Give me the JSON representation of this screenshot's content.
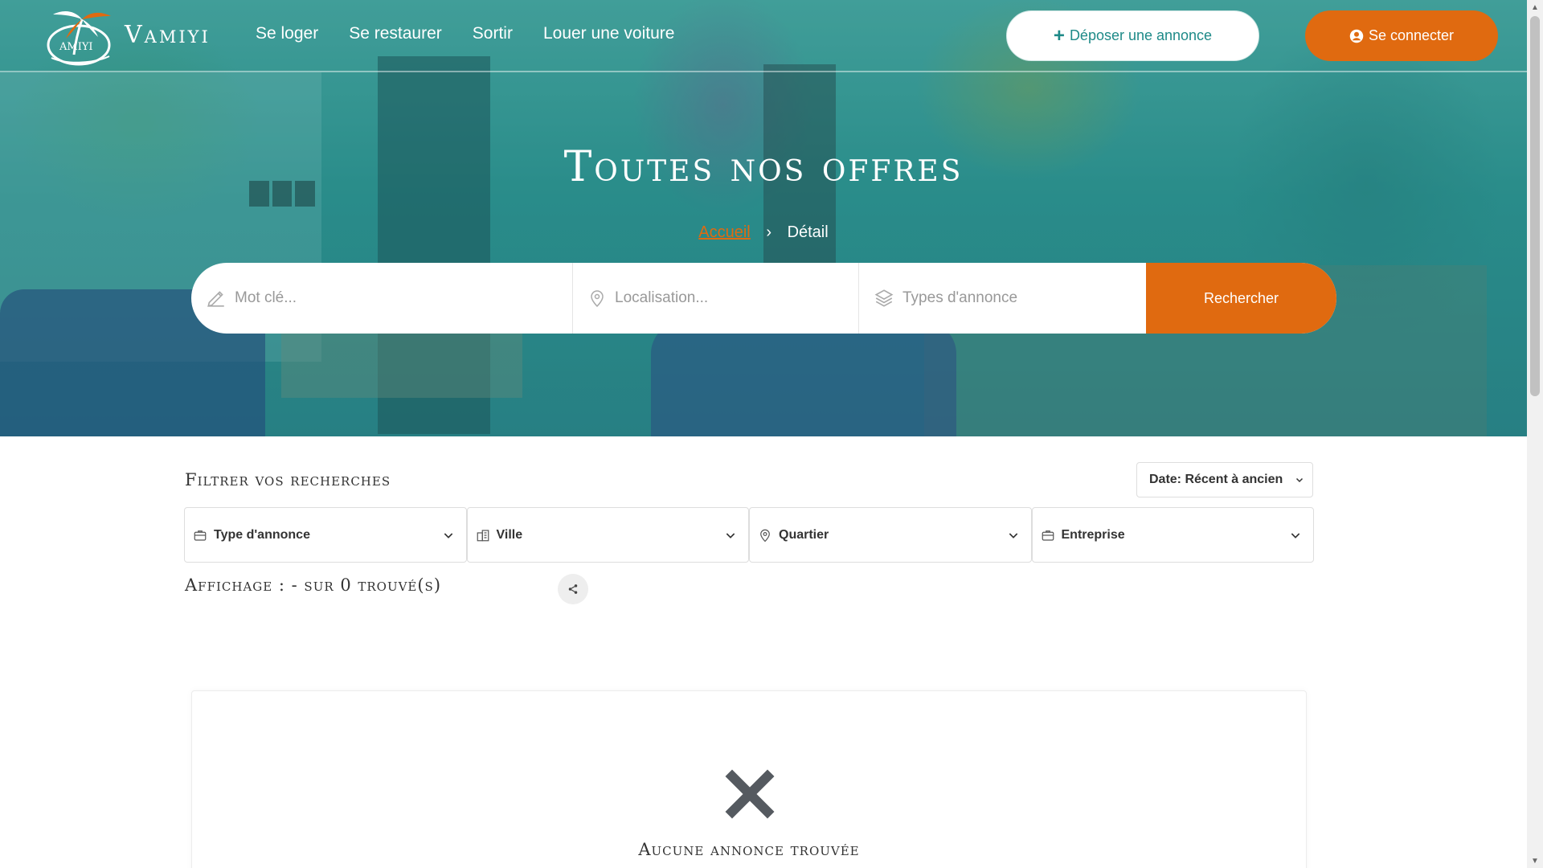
{
  "brand": {
    "name": "Vamiyi",
    "logo_text": "AMIYI"
  },
  "nav": {
    "links": [
      "Se loger",
      "Se restaurer",
      "Sortir",
      "Louer une voiture"
    ],
    "post_ad_label": "Déposer une annonce",
    "login_label": "Se connecter"
  },
  "hero": {
    "title": "Toutes nos offres",
    "breadcrumb": {
      "home": "Accueil",
      "current": "Détail"
    }
  },
  "search": {
    "keyword_placeholder": "Mot clé...",
    "location_placeholder": "Localisation...",
    "type_placeholder": "Types d'annonce",
    "submit_label": "Rechercher"
  },
  "filters": {
    "title": "Filtrer vos recherches",
    "sort_value": "Date: Récent à ancien",
    "type_label": "Type d'annonce",
    "city_label": "Ville",
    "district_label": "Quartier",
    "company_label": "Entreprise"
  },
  "results": {
    "display_text": "Affichage : - sur 0 trouvé(s)",
    "empty_message": "Aucune annonce trouvée"
  },
  "colors": {
    "accent": "#e06a10",
    "teal": "#1e8a88",
    "empty_icon": "#555a60"
  }
}
